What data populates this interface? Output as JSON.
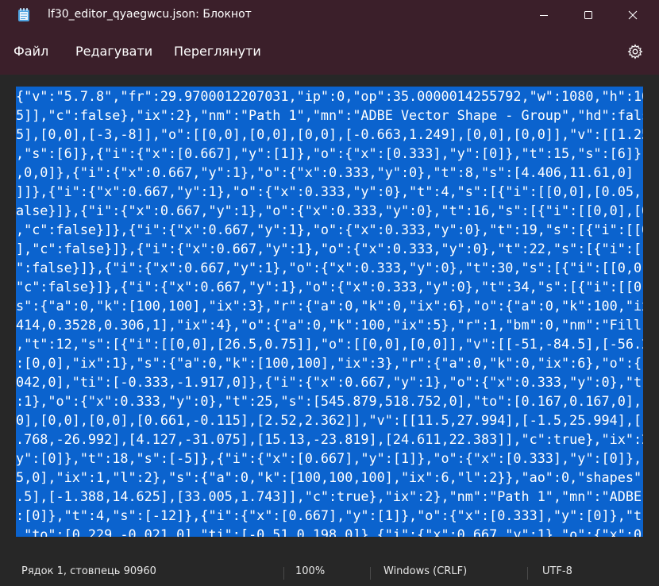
{
  "window": {
    "title": "lf30_editor_qyaegwcu.json: Блокнот",
    "icons": {
      "app": "notepad-icon",
      "minimize": "minimize-icon",
      "maximize": "maximize-icon",
      "close": "close-icon"
    }
  },
  "menu": {
    "file": "Файл",
    "edit": "Редагувати",
    "view": "Переглянути",
    "settings_icon": "gear-icon"
  },
  "editor": {
    "selection_color": "#0b63ce",
    "lines": [
      "{\"v\":\"5.7.8\",\"fr\":29.9700012207031,\"ip\":0,\"op\":35.0000014255792,\"w\":1080,\"h\":10",
      "5]],\"c\":false},\"ix\":2},\"nm\":\"Path 1\",\"mn\":\"ADBE Vector Shape - Group\",\"hd\":fals",
      "5],[0,0],[-3,-8]],\"o\":[[0,0],[0,0],[0,0],[-0.663,1.249],[0,0],[0,0]],\"v\":[[1.25",
      ",\"s\":[6]},{\"i\":{\"x\":[0.667],\"y\":[1]},\"o\":{\"x\":[0.333],\"y\":[0]},\"t\":15,\"s\":[6]},",
      ",0,0]},{\"i\":{\"x\":0.667,\"y\":1},\"o\":{\"x\":0.333,\"y\":0},\"t\":8,\"s\":[4.406,11.61,0]",
      "]]},{\"i\":{\"x\":0.667,\"y\":1},\"o\":{\"x\":0.333,\"y\":0},\"t\":4,\"s\":[{\"i\":[[0,0],[0.05,-",
      "alse}]},{\"i\":{\"x\":0.667,\"y\":1},\"o\":{\"x\":0.333,\"y\":0},\"t\":16,\"s\":[{\"i\":[[0,0],[0",
      ",\"c\":false}]},{\"i\":{\"x\":0.667,\"y\":1},\"o\":{\"x\":0.333,\"y\":0},\"t\":19,\"s\":[{\"i\":[[0",
      "],\"c\":false}]},{\"i\":{\"x\":0.667,\"y\":1},\"o\":{\"x\":0.333,\"y\":0},\"t\":22,\"s\":[{\"i\":[[",
      "\":false}]},{\"i\":{\"x\":0.667,\"y\":1},\"o\":{\"x\":0.333,\"y\":0},\"t\":30,\"s\":[{\"i\":[[0,0]",
      "\"c\":false}]},{\"i\":{\"x\":0.667,\"y\":1},\"o\":{\"x\":0.333,\"y\":0},\"t\":34,\"s\":[{\"i\":[[0,",
      "s\":{\"a\":0,\"k\":[100,100],\"ix\":3},\"r\":{\"a\":0,\"k\":0,\"ix\":6},\"o\":{\"a\":0,\"k\":100,\"ix",
      "414,0.3528,0.306,1],\"ix\":4},\"o\":{\"a\":0,\"k\":100,\"ix\":5},\"r\":1,\"bm\":0,\"nm\":\"Fill",
      ",\"t\":12,\"s\":[{\"i\":[[0,0],[26.5,0.75]],\"o\":[[0,0],[0,0]],\"v\":[[-51,-84.5],[-56.2",
      ":[0,0],\"ix\":1},\"s\":{\"a\":0,\"k\":[100,100],\"ix\":3},\"r\":{\"a\":0,\"k\":0,\"ix\":6},\"o\":{",
      "042,0],\"ti\":[-0.333,-1.917,0]},{\"i\":{\"x\":0.667,\"y\":1},\"o\":{\"x\":0.333,\"y\":0},\"t",
      ":1},\"o\":{\"x\":0.333,\"y\":0},\"t\":25,\"s\":[545.879,518.752,0],\"to\":[0.167,0.167,0],",
      "0],[0,0],[0,0],[0.661,-0.115],[2.52,2.362]],\"v\":[[11.5,27.994],[-1.5,25.994],[-",
      ".768,-26.992],[4.127,-31.075],[15.13,-23.819],[24.611,22.383]],\"c\":true},\"ix\":2",
      "y\":[0]},\"t\":18,\"s\":[-5]},{\"i\":{\"x\":[0.667],\"y\":[1]},\"o\":{\"x\":[0.333],\"y\":[0]},",
      "5,0],\"ix\":1,\"l\":2},\"s\":{\"a\":0,\"k\":[100,100,100],\"ix\":6,\"l\":2}},\"ao\":0,\"shapes\":",
      ".5],[-1.388,14.625],[33.005,1.743]],\"c\":true},\"ix\":2},\"nm\":\"Path 1\",\"mn\":\"ADBE",
      ":[0]},\"t\":4,\"s\":[-12]},{\"i\":{\"x\":[0.667],\"y\":[1]},\"o\":{\"x\":[0.333],\"y\":[0]},\"t",
      ",\"to\":[0.229,-0.021,0],\"ti\":[-0.51,0.198,0]},{\"i\":{\"x\":0.667,\"y\":1},\"o\":{\"x\":0.",
      ":0.667,\"y\":1},\"o\":{\"x\":0.333,\"y\":0},\"t\":19,\"s\":[33.098,52.074,0],\"to\":[0.896,-0",
      "5.973,58.449,0],\"to\":[1.042,1.5,0],\"ti\":[-4.292,-0.667,0]},{\"i\":{\"x\":0.667,\"y\":"
    ]
  },
  "status": {
    "position": "Рядок 1, стовпець 90960",
    "zoom": "100%",
    "line_endings": "Windows (CRLF)",
    "encoding": "UTF-8"
  }
}
